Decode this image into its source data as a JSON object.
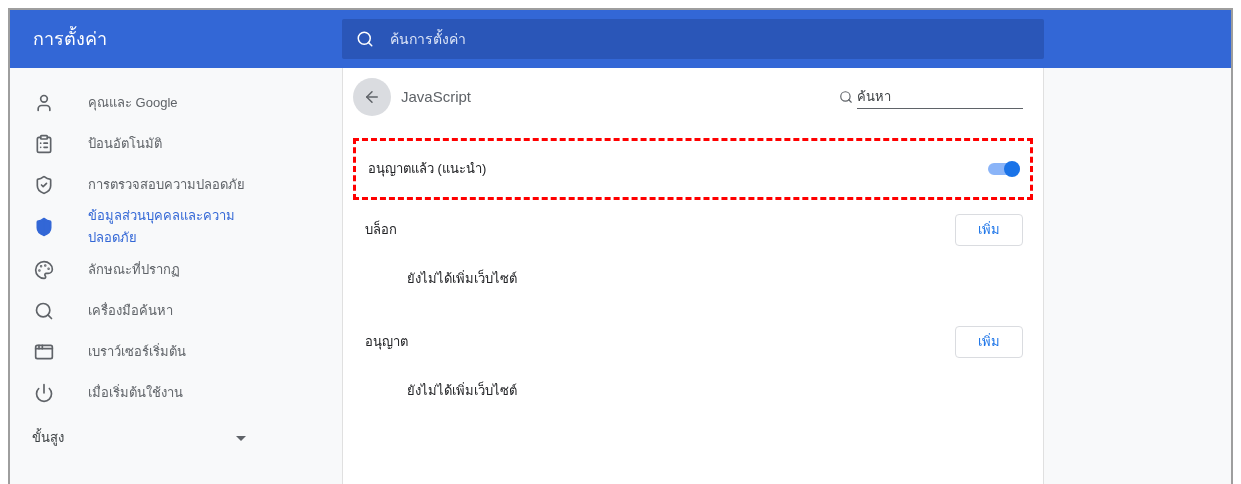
{
  "header": {
    "title": "การตั้งค่า",
    "search": {
      "placeholder": "ค้นการตั้งค่า"
    }
  },
  "sidebar": {
    "items": [
      {
        "label": "คุณและ Google",
        "selected": false
      },
      {
        "label": "ป้อนอัตโนมัติ",
        "selected": false
      },
      {
        "label": "การตรวจสอบความปลอดภัย",
        "selected": false
      },
      {
        "label": "ข้อมูลส่วนบุคคลและความปลอดภัย",
        "selected": true
      },
      {
        "label": "ลักษณะที่ปรากฏ",
        "selected": false
      },
      {
        "label": "เครื่องมือค้นหา",
        "selected": false
      },
      {
        "label": "เบราว์เซอร์เริ่มต้น",
        "selected": false
      },
      {
        "label": "เมื่อเริ่มต้นใช้งาน",
        "selected": false
      }
    ],
    "advanced": {
      "label": "ขั้นสูง",
      "expanded": false
    }
  },
  "page": {
    "title": "JavaScript",
    "search": {
      "placeholder": "ค้นหา"
    },
    "setting": {
      "label": "อนุญาตแล้ว (แนะนำ)",
      "on": true,
      "highlighted": true
    },
    "sections": [
      {
        "title": "บล็อก",
        "button": "เพิ่ม",
        "empty": "ยังไม่ได้เพิ่มเว็บไซต์"
      },
      {
        "title": "อนุญาต",
        "button": "เพิ่ม",
        "empty": "ยังไม่ได้เพิ่มเว็บไซต์"
      }
    ]
  }
}
